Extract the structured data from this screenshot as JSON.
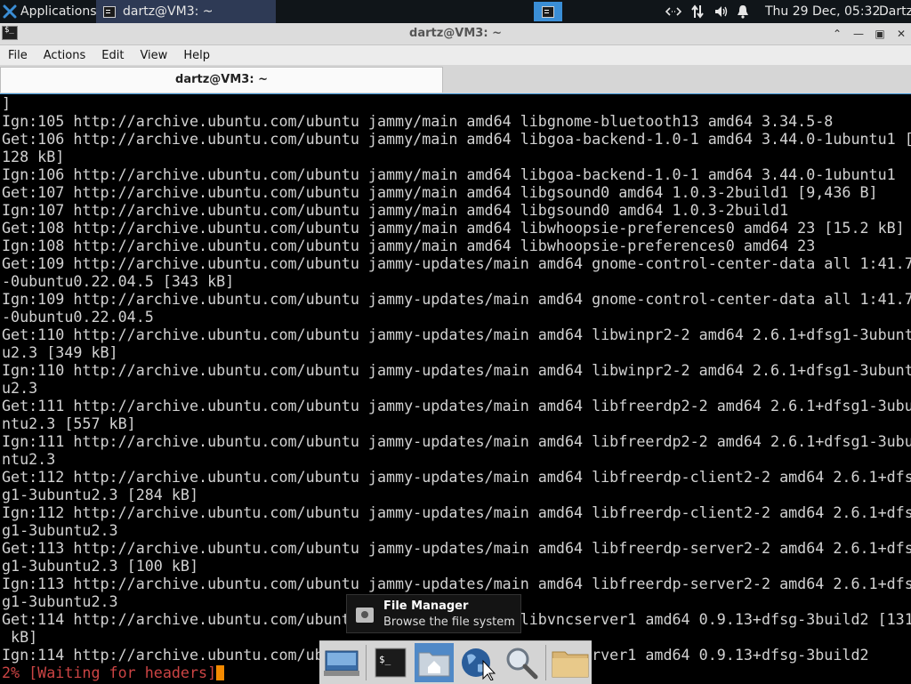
{
  "panel": {
    "applications_label": "Applications",
    "task_title": "dartz@VM3: ~",
    "clock": "Thu 29 Dec, 05:32",
    "user": "Dartz"
  },
  "window": {
    "title": "dartz@VM3: ~",
    "menu": [
      "File",
      "Actions",
      "Edit",
      "View",
      "Help"
    ],
    "tab_label": "dartz@VM3: ~"
  },
  "terminal": {
    "lines": [
      "]",
      "Ign:105 http://archive.ubuntu.com/ubuntu jammy/main amd64 libgnome-bluetooth13 amd64 3.34.5-8",
      "Get:106 http://archive.ubuntu.com/ubuntu jammy/main amd64 libgoa-backend-1.0-1 amd64 3.44.0-1ubuntu1 [",
      "128 kB]",
      "Ign:106 http://archive.ubuntu.com/ubuntu jammy/main amd64 libgoa-backend-1.0-1 amd64 3.44.0-1ubuntu1",
      "Get:107 http://archive.ubuntu.com/ubuntu jammy/main amd64 libgsound0 amd64 1.0.3-2build1 [9,436 B]",
      "Ign:107 http://archive.ubuntu.com/ubuntu jammy/main amd64 libgsound0 amd64 1.0.3-2build1",
      "Get:108 http://archive.ubuntu.com/ubuntu jammy/main amd64 libwhoopsie-preferences0 amd64 23 [15.2 kB]",
      "Ign:108 http://archive.ubuntu.com/ubuntu jammy/main amd64 libwhoopsie-preferences0 amd64 23",
      "Get:109 http://archive.ubuntu.com/ubuntu jammy-updates/main amd64 gnome-control-center-data all 1:41.7",
      "-0ubuntu0.22.04.5 [343 kB]",
      "Ign:109 http://archive.ubuntu.com/ubuntu jammy-updates/main amd64 gnome-control-center-data all 1:41.7",
      "-0ubuntu0.22.04.5",
      "Get:110 http://archive.ubuntu.com/ubuntu jammy-updates/main amd64 libwinpr2-2 amd64 2.6.1+dfsg1-3ubunt",
      "u2.3 [349 kB]",
      "Ign:110 http://archive.ubuntu.com/ubuntu jammy-updates/main amd64 libwinpr2-2 amd64 2.6.1+dfsg1-3ubunt",
      "u2.3",
      "Get:111 http://archive.ubuntu.com/ubuntu jammy-updates/main amd64 libfreerdp2-2 amd64 2.6.1+dfsg1-3ubu",
      "ntu2.3 [557 kB]",
      "Ign:111 http://archive.ubuntu.com/ubuntu jammy-updates/main amd64 libfreerdp2-2 amd64 2.6.1+dfsg1-3ubu",
      "ntu2.3",
      "Get:112 http://archive.ubuntu.com/ubuntu jammy-updates/main amd64 libfreerdp-client2-2 amd64 2.6.1+dfs",
      "g1-3ubuntu2.3 [284 kB]",
      "Ign:112 http://archive.ubuntu.com/ubuntu jammy-updates/main amd64 libfreerdp-client2-2 amd64 2.6.1+dfs",
      "g1-3ubuntu2.3",
      "Get:113 http://archive.ubuntu.com/ubuntu jammy-updates/main amd64 libfreerdp-server2-2 amd64 2.6.1+dfs",
      "g1-3ubuntu2.3 [100 kB]",
      "Ign:113 http://archive.ubuntu.com/ubuntu jammy-updates/main amd64 libfreerdp-server2-2 amd64 2.6.1+dfs",
      "g1-3ubuntu2.3",
      "Get:114 http://archive.ubuntu.com/ubuntu jammy/main amd64 libvncserver1 amd64 0.9.13+dfsg-3build2 [131",
      " kB]",
      "Ign:114 http://archive.ubuntu.com/ubuntu jammy/main amd64 libvncserver1 amd64 0.9.13+dfsg-3build2"
    ],
    "status_line": "2% [Waiting for headers]"
  },
  "tooltip": {
    "name": "File Manager",
    "description": "Browse the file system"
  },
  "colors": {
    "accent": "#3c93d6",
    "active_task": "#2e3a55",
    "cursor": "#f48a00",
    "status_text": "#cc4444"
  }
}
